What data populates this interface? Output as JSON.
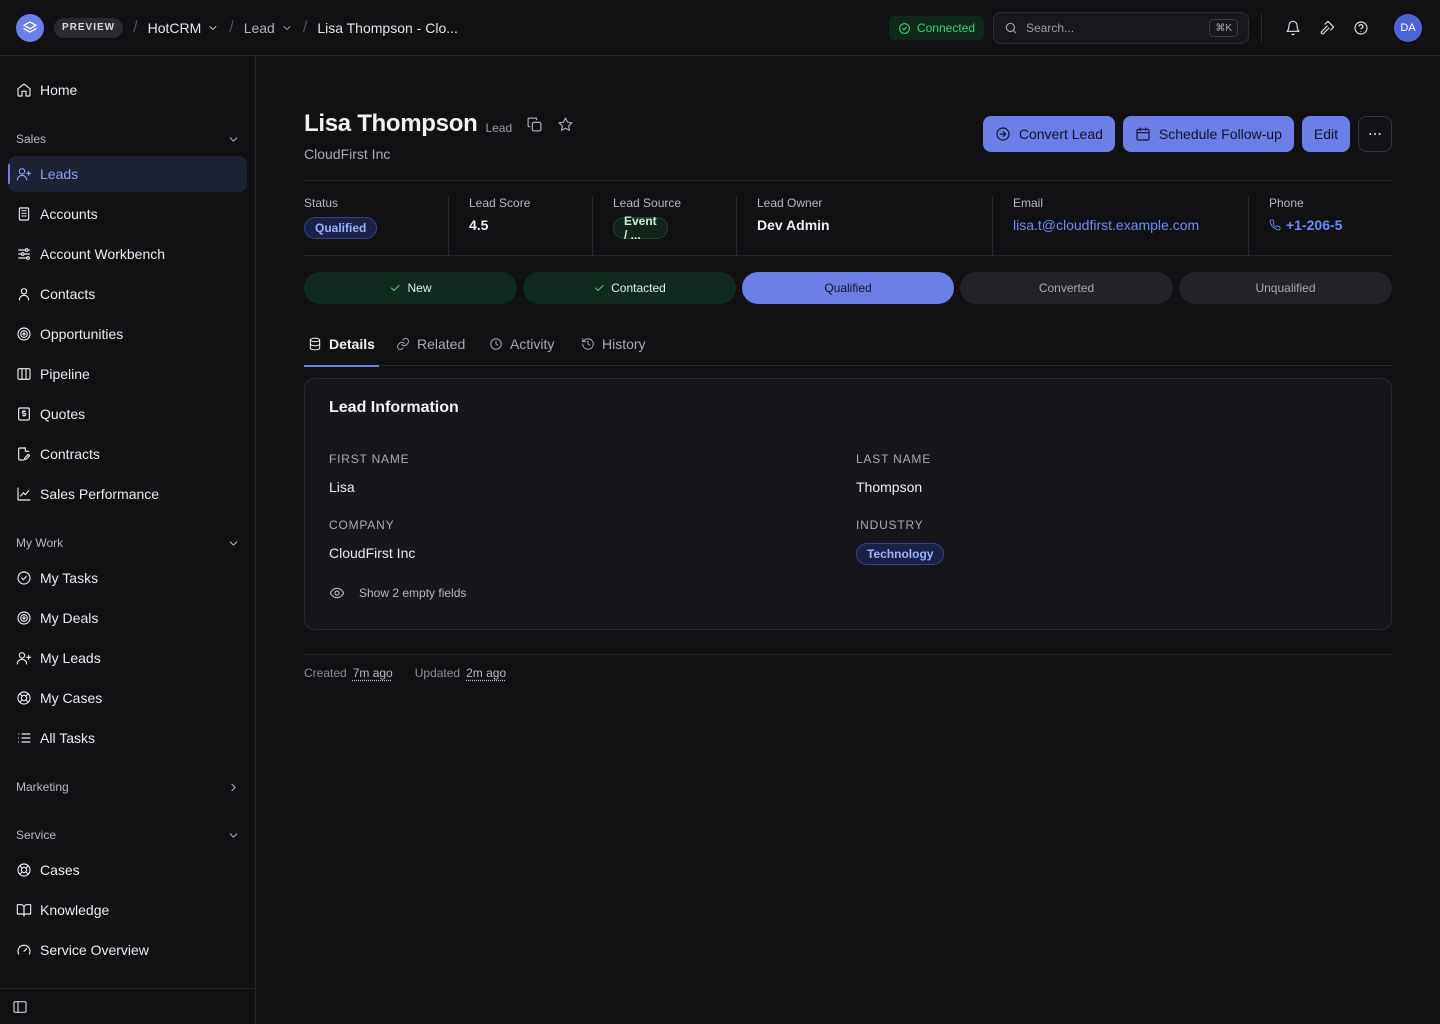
{
  "topbar": {
    "preview_label": "PREVIEW",
    "breadcrumbs": [
      {
        "label": "HotCRM"
      },
      {
        "label": "Lead"
      },
      {
        "label": "Lisa Thompson - Clo..."
      }
    ],
    "connection_status": "Connected",
    "search_placeholder": "Search...",
    "search_shortcut": "⌘K",
    "avatar_initials": "DA"
  },
  "sidebar": {
    "home": "Home",
    "groups": {
      "sales": "Sales",
      "my_work": "My Work",
      "marketing": "Marketing",
      "service": "Service"
    },
    "sales_items": [
      "Leads",
      "Accounts",
      "Account Workbench",
      "Contacts",
      "Opportunities",
      "Pipeline",
      "Quotes",
      "Contracts",
      "Sales Performance"
    ],
    "my_work_items": [
      "My Tasks",
      "My Deals",
      "My Leads",
      "My Cases",
      "All Tasks"
    ],
    "service_items": [
      "Cases",
      "Knowledge",
      "Service Overview"
    ]
  },
  "record": {
    "name": "Lisa Thompson",
    "type": "Lead",
    "company": "CloudFirst Inc",
    "actions": {
      "convert": "Convert Lead",
      "schedule": "Schedule Follow-up",
      "edit": "Edit"
    },
    "highlights": {
      "status_label": "Status",
      "status_value": "Qualified",
      "score_label": "Lead Score",
      "score_value": "4.5",
      "source_label": "Lead Source",
      "source_value": "Event / ...",
      "owner_label": "Lead Owner",
      "owner_value": "Dev Admin",
      "email_label": "Email",
      "email_value": "lisa.t@cloudfirst.example.com",
      "phone_label": "Phone",
      "phone_value": "+1-206-5"
    },
    "stages": [
      "New",
      "Contacted",
      "Qualified",
      "Converted",
      "Unqualified"
    ],
    "tabs": [
      "Details",
      "Related",
      "Activity",
      "History"
    ],
    "details": {
      "section_title": "Lead Information",
      "first_name_label": "FIRST NAME",
      "first_name": "Lisa",
      "last_name_label": "LAST NAME",
      "last_name": "Thompson",
      "company_label": "COMPANY",
      "company": "CloudFirst Inc",
      "industry_label": "INDUSTRY",
      "industry": "Technology",
      "show_empty": "Show 2 empty fields"
    },
    "meta": {
      "created_label": "Created",
      "created_value": "7m ago",
      "updated_label": "Updated",
      "updated_value": "2m ago"
    }
  },
  "colors": {
    "accent": "#6b7fe6",
    "background": "#111114",
    "success": "#3ecf72",
    "link": "#6f8cf5"
  }
}
